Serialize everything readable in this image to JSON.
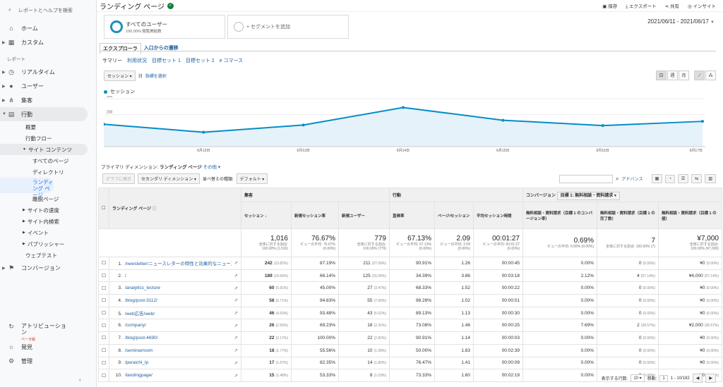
{
  "sidebar": {
    "search_placeholder": "レポートとヘルプを検索",
    "top": [
      {
        "label": "ホーム",
        "icon": "home-icon"
      },
      {
        "label": "カスタム",
        "icon": "dashboard-icon"
      }
    ],
    "section_label": "レポート",
    "reports": [
      {
        "label": "リアルタイム",
        "icon": "clock-icon"
      },
      {
        "label": "ユーザー",
        "icon": "person-icon"
      },
      {
        "label": "集客",
        "icon": "acquisition-icon"
      },
      {
        "label": "行動",
        "icon": "behavior-icon"
      }
    ],
    "behavior_sub": [
      "概要",
      "行動フロー"
    ],
    "site_content": "サイト コンテンツ",
    "site_content_sub": [
      "すべてのページ",
      "ディレクトリ",
      "ランディング ページ",
      "離脱ページ"
    ],
    "behavior_more": [
      "サイトの速度",
      "サイト内検索",
      "イベント",
      "パブリッシャー"
    ],
    "web_test": "ウェブテスト",
    "conversion": "コンバージョン",
    "attribution": "アトリビューション",
    "beta": "ベータ版",
    "discover": "発見",
    "admin": "管理"
  },
  "header": {
    "title": "ランディング ページ",
    "actions": [
      "保存",
      "エクスポート",
      "共有",
      "インサイト"
    ]
  },
  "segments": {
    "all_users": "すべてのユーザー",
    "all_users_sub": "100.00% 閲覧開始数",
    "add_segment": "+ セグメントを追加"
  },
  "date_range": "2021/06/11 - 2021/06/17",
  "tabs": [
    "エクスプローラ",
    "入口からの遷移"
  ],
  "subnav": [
    "サマリー",
    "利用状況",
    "目標セット 1",
    "目標セット 2",
    "e コマース"
  ],
  "chart_ctrl": {
    "metric": "セッション",
    "vs": "対",
    "select_metric": "指標を選択",
    "periods": [
      "日",
      "週",
      "月"
    ]
  },
  "chart_data": {
    "type": "area",
    "series": [
      {
        "name": "セッション",
        "values": [
          140,
          90,
          135,
          245,
          165,
          132,
          158
        ]
      }
    ],
    "x": [
      "",
      "6月12日",
      "6月13日",
      "6月14日",
      "6月15日",
      "6月16日",
      "6月17日"
    ],
    "yticks": [
      100,
      200,
      300
    ],
    "ylim": [
      0,
      300
    ]
  },
  "dimension": {
    "label": "プライマリ ディメンション:",
    "value": "ランディング ページ",
    "other": "その他"
  },
  "filters": {
    "plot": "グラフに表示",
    "secondary": "セカンダリ ディメンション",
    "sort_label": "並べ替えの種類:",
    "sort": "デフォルト",
    "advanced": "アドバンス"
  },
  "table": {
    "group_headers": [
      "集客",
      "行動",
      "コンバージョン",
      "目標 1: 無料相談・資料請求"
    ],
    "col_landing": "ランディング ページ",
    "cols": [
      "セッション",
      "新規セッション率",
      "新規ユーザー",
      "直帰率",
      "ページ/セッション",
      "平均セッション時間",
      "無料相談・資料請求（目標 1 のコンバージョン率）",
      "無料相談・資料請求（目標 1 の完了数）",
      "無料相談・資料請求（目標 1 の値）"
    ],
    "totals": [
      {
        "v": "1,016",
        "s1": "全体に対する割合:",
        "s2": "100.00% (1,016)"
      },
      {
        "v": "76.67%",
        "s1": "ビューの平均: 76.67%",
        "s2": "(0.00%)"
      },
      {
        "v": "779",
        "s1": "全体に対する割合:",
        "s2": "100.00% (779)"
      },
      {
        "v": "67.13%",
        "s1": "ビューの平均: 67.13%",
        "s2": "(0.00%)"
      },
      {
        "v": "2.09",
        "s1": "ビューの平均: 2.09",
        "s2": "(0.00%)"
      },
      {
        "v": "00:01:27",
        "s1": "ビューの平均: 00:01:27",
        "s2": "(0.00%)"
      },
      {
        "v": "0.69%",
        "s1": "ビューの平均: 0.69% (0.00%)",
        "s2": ""
      },
      {
        "v": "7",
        "s1": "全体に対する割合: 100.00% (7)",
        "s2": ""
      },
      {
        "v": "¥7,000",
        "s1": "全体に対する割合:",
        "s2": "100.00% (¥7,000)"
      }
    ],
    "rows": [
      {
        "n": "1.",
        "page": "/newsletter/ニュースレターの特性と効果的なニュースレター/",
        "s": "242",
        "sp": "(23.82%)",
        "ns": "87.19%",
        "nu": "211",
        "nup": "(27.09%)",
        "b": "90.91%",
        "pps": "1.26",
        "t": "00:00:45",
        "cr": "0.00%",
        "c": "0",
        "cp": "(0.00%)",
        "val": "¥0",
        "vp": "(0.00%)"
      },
      {
        "n": "2.",
        "page": "/",
        "s": "189",
        "sp": "(18.60%)",
        "ns": "66.14%",
        "nu": "125",
        "nup": "(16.05%)",
        "b": "34.39%",
        "pps": "3.86",
        "t": "00:03:18",
        "cr": "2.12%",
        "c": "4",
        "cp": "(57.14%)",
        "val": "¥4,000",
        "vp": "(57.14%)"
      },
      {
        "n": "3.",
        "page": "/analytics_lecture",
        "s": "60",
        "sp": "(5.91%)",
        "ns": "45.00%",
        "nu": "27",
        "nup": "(3.47%)",
        "b": "68.33%",
        "pps": "1.52",
        "t": "00:00:22",
        "cr": "0.00%",
        "c": "0",
        "cp": "(0.00%)",
        "val": "¥0",
        "vp": "(0.00%)"
      },
      {
        "n": "4.",
        "page": "/blog/post-3112/",
        "s": "58",
        "sp": "(5.71%)",
        "ns": "94.83%",
        "nu": "55",
        "nup": "(7.06%)",
        "b": "98.28%",
        "pps": "1.02",
        "t": "00:00:01",
        "cr": "0.00%",
        "c": "0",
        "cp": "(0.00%)",
        "val": "¥0",
        "vp": "(0.00%)"
      },
      {
        "n": "5.",
        "page": "/web広告/web/",
        "s": "46",
        "sp": "(4.53%)",
        "ns": "93.48%",
        "nu": "43",
        "nup": "(5.52%)",
        "b": "89.13%",
        "pps": "1.13",
        "t": "00:00:30",
        "cr": "0.00%",
        "c": "0",
        "cp": "(0.00%)",
        "val": "¥0",
        "vp": "(0.00%)"
      },
      {
        "n": "6.",
        "page": "/company/",
        "s": "26",
        "sp": "(2.56%)",
        "ns": "69.23%",
        "nu": "18",
        "nup": "(2.31%)",
        "b": "73.08%",
        "pps": "1.46",
        "t": "00:00:25",
        "cr": "7.69%",
        "c": "2",
        "cp": "(28.57%)",
        "val": "¥2,000",
        "vp": "(28.57%)"
      },
      {
        "n": "7.",
        "page": "/blog/post-4690/",
        "s": "22",
        "sp": "(2.17%)",
        "ns": "100.00%",
        "nu": "22",
        "nup": "(2.82%)",
        "b": "90.91%",
        "pps": "1.14",
        "t": "00:00:03",
        "cr": "0.00%",
        "c": "0",
        "cp": "(0.00%)",
        "val": "¥0",
        "vp": "(0.00%)"
      },
      {
        "n": "8.",
        "page": "/seminarroom",
        "s": "18",
        "sp": "(1.77%)",
        "ns": "55.56%",
        "nu": "10",
        "nup": "(1.28%)",
        "b": "50.00%",
        "pps": "1.83",
        "t": "00:02:39",
        "cr": "0.00%",
        "c": "0",
        "cp": "(0.00%)",
        "val": "¥0",
        "vp": "(0.00%)"
      },
      {
        "n": "9.",
        "page": "/peraichi_lp",
        "s": "17",
        "sp": "(1.67%)",
        "ns": "82.35%",
        "nu": "14",
        "nup": "(1.80%)",
        "b": "76.47%",
        "pps": "1.41",
        "t": "00:00:09",
        "cr": "0.00%",
        "c": "0",
        "cp": "(0.00%)",
        "val": "¥0",
        "vp": "(0.00%)"
      },
      {
        "n": "10.",
        "page": "/landingpage/",
        "s": "15",
        "sp": "(1.48%)",
        "ns": "53.33%",
        "nu": "8",
        "nup": "(1.03%)",
        "b": "73.33%",
        "pps": "1.60",
        "t": "00:02:19",
        "cr": "0.00%",
        "c": "0",
        "cp": "(0.00%)",
        "val": "¥0",
        "vp": "(0.00%)"
      }
    ]
  },
  "pager": {
    "rows_label": "表示する行数:",
    "rows": "10",
    "goto": "移動:",
    "page": "1",
    "range": "1 - 10/182"
  },
  "colors": {
    "accent": "#058dc7",
    "link": "#1f5f9f"
  }
}
